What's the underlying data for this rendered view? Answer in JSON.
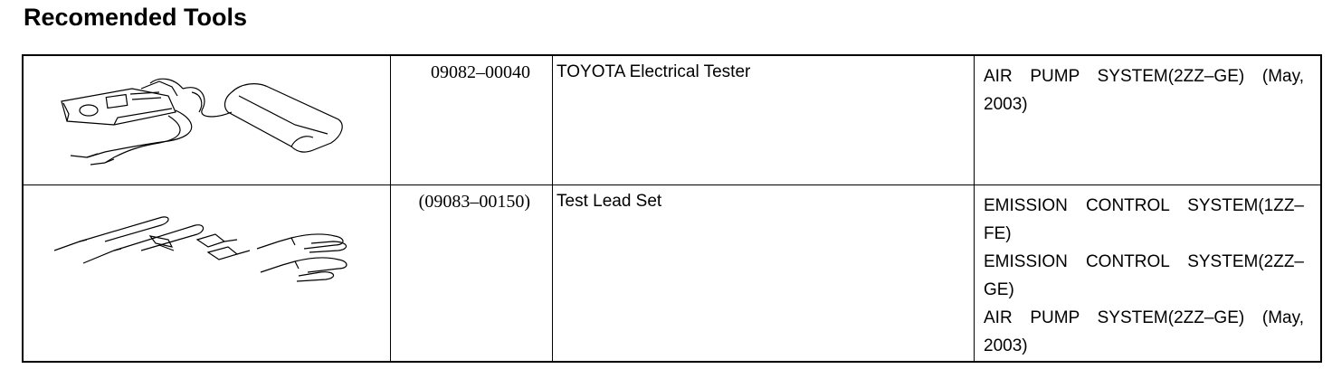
{
  "page": {
    "title": "Recomended Tools"
  },
  "tools": [
    {
      "part_no": "09082–00040",
      "name": "TOYOTA Electrical Tester",
      "icon": "electrical-tester-illustration",
      "references": [
        "AIR PUMP SYSTEM(2ZZ–GE) (May, 2003)"
      ]
    },
    {
      "part_no": "(09083–00150)",
      "name": "Test Lead Set",
      "icon": "test-lead-set-illustration",
      "references": [
        "EMISSION CONTROL SYSTEM(1ZZ–FE)",
        "EMISSION CONTROL SYSTEM(2ZZ–GE)",
        "AIR PUMP SYSTEM(2ZZ–GE) (May, 2003)"
      ]
    }
  ]
}
